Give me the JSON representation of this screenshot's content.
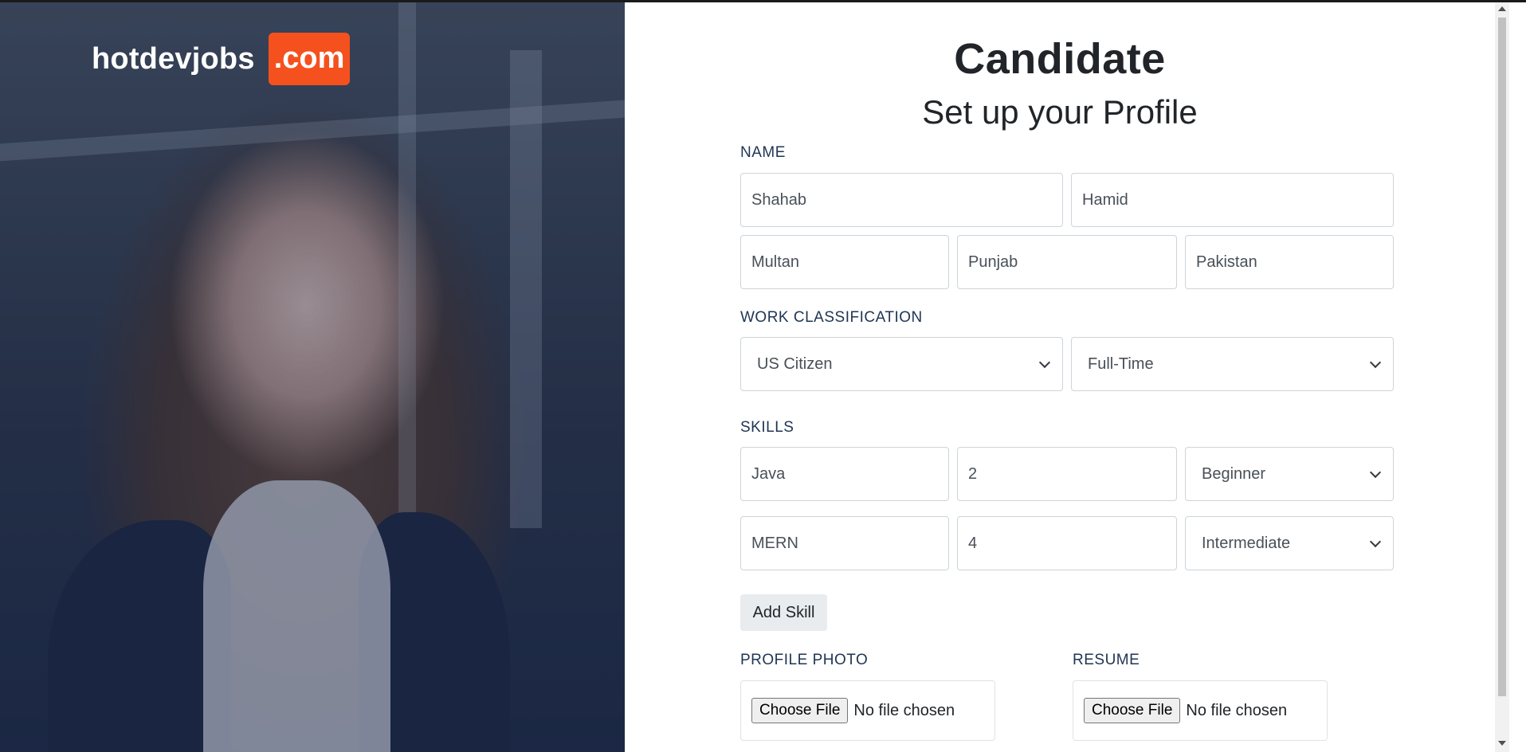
{
  "brand": {
    "name": "hotdevjobs",
    "tld": ".com"
  },
  "header": {
    "title": "Candidate",
    "subtitle": "Set up your Profile"
  },
  "sections": {
    "name": "NAME",
    "work": "WORK CLASSIFICATION",
    "skills": "SKILLS",
    "photo": "PROFILE PHOTO",
    "resume": "RESUME"
  },
  "name_fields": {
    "first": "Shahab",
    "last": "Hamid",
    "city": "Multan",
    "state": "Punjab",
    "country": "Pakistan"
  },
  "work": {
    "status": "US Citizen",
    "type": "Full-Time"
  },
  "skills": [
    {
      "name": "Java",
      "years": "2",
      "level": "Beginner"
    },
    {
      "name": "MERN",
      "years": "4",
      "level": "Intermediate"
    }
  ],
  "add_skill_label": "Add Skill",
  "file": {
    "button": "Choose File",
    "status": "No file chosen"
  },
  "colors": {
    "accent": "#f4511e",
    "section_text": "#1f3553"
  }
}
